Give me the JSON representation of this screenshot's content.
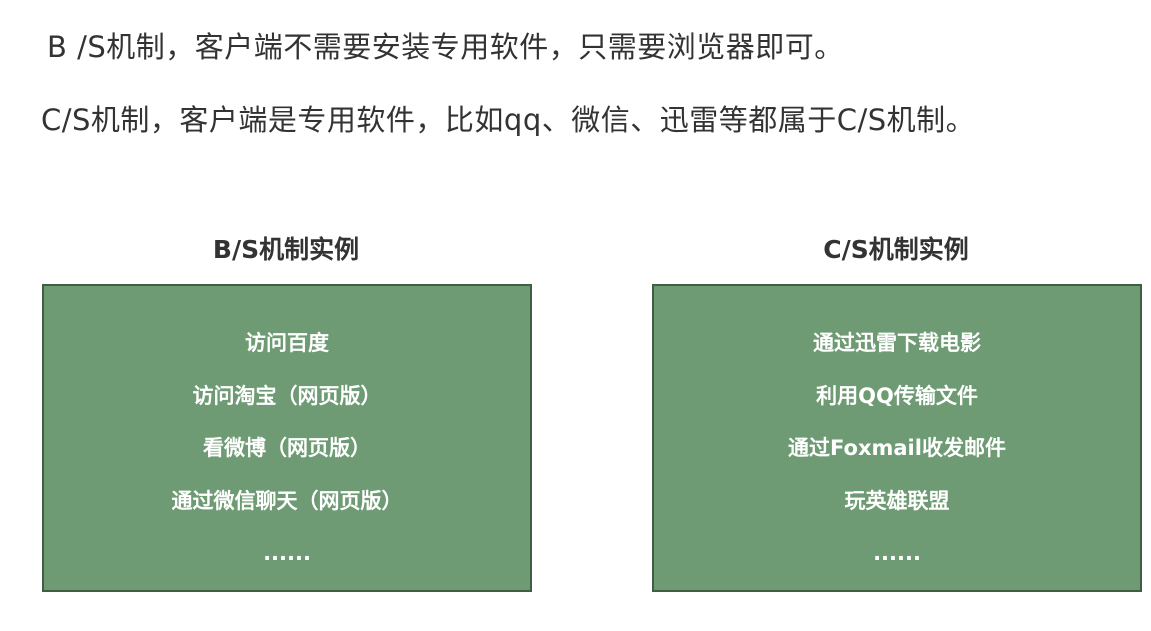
{
  "intro": {
    "bs_line": "B /S机制，客户端不需要安装专用软件，只需要浏览器即可。",
    "cs_line": "C/S机制，客户端是专用软件，比如qq、微信、迅雷等都属于C/S机制。"
  },
  "bs_panel": {
    "title": "B/S机制实例",
    "items": [
      "访问百度",
      "访问淘宝（网页版）",
      "看微博（网页版）",
      "通过微信聊天（网页版）",
      "......"
    ]
  },
  "cs_panel": {
    "title": "C/S机制实例",
    "items": [
      "通过迅雷下载电影",
      "利用QQ传输文件",
      "通过Foxmail收发邮件",
      "玩英雄联盟",
      "......"
    ]
  },
  "colors": {
    "box_fill": "#6e9b74",
    "box_border": "#3f5f45",
    "text": "#333333",
    "box_text": "#ffffff"
  }
}
